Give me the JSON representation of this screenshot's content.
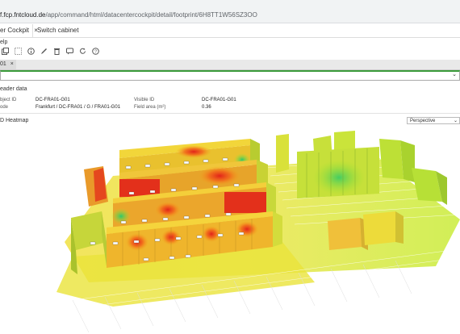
{
  "browser": {
    "url_host": "f.fcp.fntcloud.de",
    "url_path": "/app/command/html/datacentercockpit/detail/footprint/6H8TT1W56SZ3OO"
  },
  "tabs": [
    {
      "label": "er Cockpit",
      "close": "×"
    },
    {
      "label": "Switch cabinet"
    }
  ],
  "menu": {
    "label": "elp"
  },
  "toolbar": {
    "icons": [
      "copy-icon",
      "select-icon",
      "info-icon",
      "edit-icon",
      "delete-icon",
      "chat-icon",
      "refresh-icon",
      "help-icon"
    ]
  },
  "subtab": {
    "label": "01",
    "close": "×"
  },
  "header": {
    "section_title": "eader data",
    "object_id_label": "bject ID",
    "object_id_value": "DC-FRA01-G01",
    "visible_id_label": "Visible ID",
    "visible_id_value": "DC-FRA01-G01",
    "path_label": "ode",
    "path_value": "Frankfurt / DC-FRA01 / G / FRA01-G01",
    "field_area_label": "Field area (m²)",
    "field_area_value": "0.36"
  },
  "heatmap": {
    "title": "D Heatmap",
    "view_select": "Perspective",
    "colors": {
      "hot": "#e2231a",
      "warm": "#f5a31a",
      "mid": "#e7e32a",
      "cool": "#9be22a",
      "cold": "#2ec96a"
    }
  }
}
